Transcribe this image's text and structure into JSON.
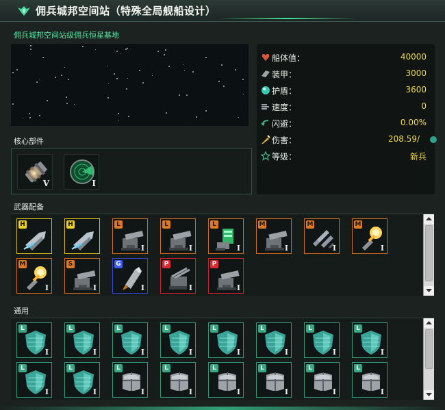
{
  "window": {
    "title": "佣兵城邦空间站（特殊全局舰船设计）"
  },
  "subtitle": "佣兵城邦空间站级佣兵恒星基地",
  "stats": [
    {
      "label": "船体值：",
      "value": "40000",
      "icon": "hull-heart-icon",
      "color": "#e0553a"
    },
    {
      "label": "装甲：",
      "value": "3000",
      "icon": "armor-icon",
      "color": "#9aa3a8"
    },
    {
      "label": "护盾：",
      "value": "3600",
      "icon": "shield-orb-icon",
      "color": "#39c8b0"
    },
    {
      "label": "速度：",
      "value": "0",
      "icon": "speed-icon",
      "color": "#9aa3a8"
    },
    {
      "label": "闪避：",
      "value": "0.00%",
      "icon": "evasion-icon",
      "color": "#49b07f"
    },
    {
      "label": "伤害：",
      "value": "208.59/",
      "icon": "damage-icon",
      "color": "#e8b23a"
    },
    {
      "label": "等级：",
      "value": "新兵",
      "icon": "rank-star-icon",
      "color": "#49b07f"
    }
  ],
  "sections": {
    "core": "核心部件",
    "weapons": "武器配备",
    "general": "通用"
  },
  "core_slots": [
    {
      "name": "reactor",
      "roman": "V"
    },
    {
      "name": "sensor",
      "roman": "I"
    }
  ],
  "weapon_slots": [
    {
      "badge": "H",
      "color": "yellow",
      "art": "missile-pod",
      "roman": ""
    },
    {
      "badge": "H",
      "color": "yellow",
      "art": "missile-pod",
      "roman": ""
    },
    {
      "badge": "L",
      "color": "orange",
      "art": "turret",
      "roman": "I"
    },
    {
      "badge": "L",
      "color": "orange",
      "art": "turret",
      "roman": "I"
    },
    {
      "badge": "L",
      "color": "orange",
      "art": "green-laser",
      "roman": "I"
    },
    {
      "badge": "M",
      "color": "orange",
      "art": "turret",
      "roman": "I"
    },
    {
      "badge": "M",
      "color": "orange",
      "art": "missiles",
      "roman": "I"
    },
    {
      "badge": "M",
      "color": "orange",
      "art": "plasma",
      "roman": "I"
    },
    {
      "badge": "M",
      "color": "orange",
      "art": "plasma",
      "roman": "I"
    },
    {
      "badge": "S",
      "color": "orange",
      "art": "turret",
      "roman": "I"
    },
    {
      "badge": "G",
      "color": "blue",
      "art": "torpedo",
      "roman": "I"
    },
    {
      "badge": "P",
      "color": "red",
      "art": "flak",
      "roman": "I"
    },
    {
      "badge": "P",
      "color": "red",
      "art": "turret",
      "roman": "I"
    }
  ],
  "general_slots": [
    {
      "badge": "L",
      "art": "shield",
      "roman": "I"
    },
    {
      "badge": "L",
      "art": "shield",
      "roman": "I"
    },
    {
      "badge": "L",
      "art": "shield",
      "roman": "I"
    },
    {
      "badge": "L",
      "art": "shield",
      "roman": "I"
    },
    {
      "badge": "L",
      "art": "shield",
      "roman": "I"
    },
    {
      "badge": "L",
      "art": "shield",
      "roman": "I"
    },
    {
      "badge": "L",
      "art": "shield",
      "roman": "I"
    },
    {
      "badge": "L",
      "art": "shield",
      "roman": "I"
    },
    {
      "badge": "L",
      "art": "shield",
      "roman": "I"
    },
    {
      "badge": "L",
      "art": "shield",
      "roman": "I"
    },
    {
      "badge": "L",
      "art": "armor",
      "roman": "I"
    },
    {
      "badge": "L",
      "art": "armor",
      "roman": "I"
    },
    {
      "badge": "L",
      "art": "armor",
      "roman": "I"
    },
    {
      "badge": "L",
      "art": "armor",
      "roman": "I"
    },
    {
      "badge": "L",
      "art": "armor",
      "roman": "I"
    },
    {
      "badge": "L",
      "art": "armor",
      "roman": "I"
    }
  ]
}
